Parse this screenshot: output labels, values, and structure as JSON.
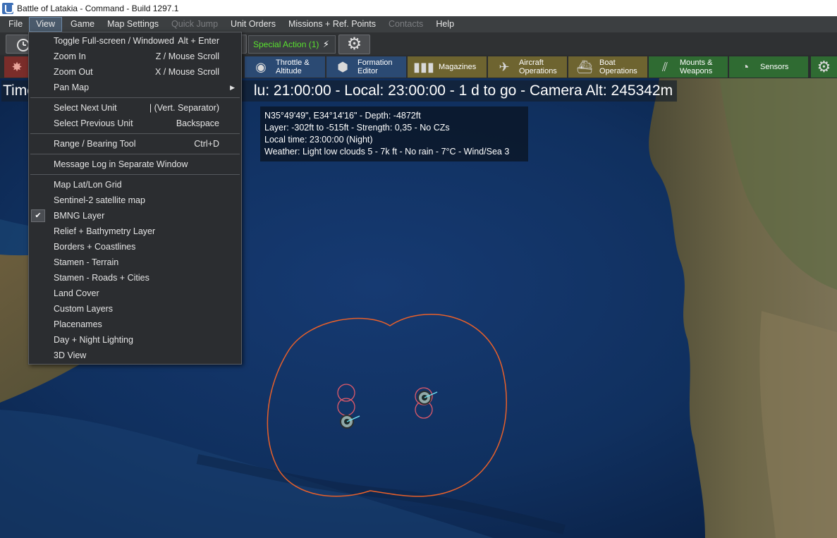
{
  "window": {
    "title": "Battle of Latakia - Command - Build 1297.1"
  },
  "menubar": {
    "items": [
      {
        "label": "File",
        "state": "normal"
      },
      {
        "label": "View",
        "state": "active"
      },
      {
        "label": "Game",
        "state": "normal"
      },
      {
        "label": "Map Settings",
        "state": "normal"
      },
      {
        "label": "Quick Jump",
        "state": "disabled"
      },
      {
        "label": "Unit Orders",
        "state": "normal"
      },
      {
        "label": "Missions + Ref. Points",
        "state": "normal"
      },
      {
        "label": "Contacts",
        "state": "disabled"
      },
      {
        "label": "Help",
        "state": "normal"
      }
    ]
  },
  "toolbar1": {
    "special_action": "Special Action (1)",
    "bolt_icon": "lightning-icon",
    "gear_icon": "gear-icon"
  },
  "toolbar2": {
    "buttons": [
      {
        "label_1": "Throttle &",
        "label_2": "Altitude",
        "icon": "throttle-icon"
      },
      {
        "label_1": "Formation",
        "label_2": "Editor",
        "icon": "formation-icon"
      },
      {
        "label_1": "Magazines",
        "label_2": "",
        "icon": "magazine-icon"
      },
      {
        "label_1": "Aircraft",
        "label_2": "Operations",
        "icon": "aircraft-icon"
      },
      {
        "label_1": "Boat",
        "label_2": "Operations",
        "icon": "boat-icon"
      },
      {
        "label_1": "Mounts &",
        "label_2": "Weapons",
        "icon": "weapons-icon"
      },
      {
        "label_1": "Sensors",
        "label_2": "",
        "icon": "sensor-icon"
      }
    ]
  },
  "status": {
    "prefix": "Time",
    "rest": "lu: 21:00:00 - Local: 23:00:00 - 1 d to go -  Camera Alt: 245342m"
  },
  "info": {
    "line1": "N35°49'49\", E34°14'16\" - Depth: -4872ft",
    "line2": "Layer: -302ft to -515ft - Strength: 0,35 - No CZs",
    "line3": "Local time: 23:00:00 (Night)",
    "line4": "Weather: Light low clouds 5 - 7k ft - No rain - 7°C - Wind/Sea 3"
  },
  "view_menu": {
    "items": [
      {
        "label": "Toggle Full-screen / Windowed",
        "shortcut": "Alt + Enter"
      },
      {
        "label": "Zoom In",
        "shortcut": "Z / Mouse Scroll"
      },
      {
        "label": "Zoom Out",
        "shortcut": "X / Mouse Scroll"
      },
      {
        "label": "Pan Map",
        "shortcut": ""
      },
      {
        "label": "Select Next Unit",
        "shortcut": "| (Vert. Separator)"
      },
      {
        "label": "Select Previous Unit",
        "shortcut": "Backspace"
      },
      {
        "label": "Range / Bearing Tool",
        "shortcut": "Ctrl+D"
      },
      {
        "label": "Message Log in Separate Window",
        "shortcut": ""
      },
      {
        "label": "Map Lat/Lon Grid",
        "shortcut": ""
      },
      {
        "label": "Sentinel-2 satellite map",
        "shortcut": ""
      },
      {
        "label": "BMNG Layer",
        "shortcut": "",
        "checked": true
      },
      {
        "label": "Relief + Bathymetry Layer",
        "shortcut": ""
      },
      {
        "label": "Borders + Coastlines",
        "shortcut": ""
      },
      {
        "label": "Stamen - Terrain",
        "shortcut": ""
      },
      {
        "label": "Stamen - Roads + Cities",
        "shortcut": ""
      },
      {
        "label": "Land Cover",
        "shortcut": ""
      },
      {
        "label": "Custom Layers",
        "shortcut": ""
      },
      {
        "label": "Placenames",
        "shortcut": ""
      },
      {
        "label": "Day + Night Lighting",
        "shortcut": ""
      },
      {
        "label": "3D View",
        "shortcut": ""
      }
    ]
  },
  "colors": {
    "range_ring": "#e8602a",
    "unit_ring": "#e05a6a",
    "unit_marker": "#8fa8a8",
    "heading_line": "#6ee0f0",
    "sea": "#0f2c5c",
    "land": "#6b6445"
  }
}
